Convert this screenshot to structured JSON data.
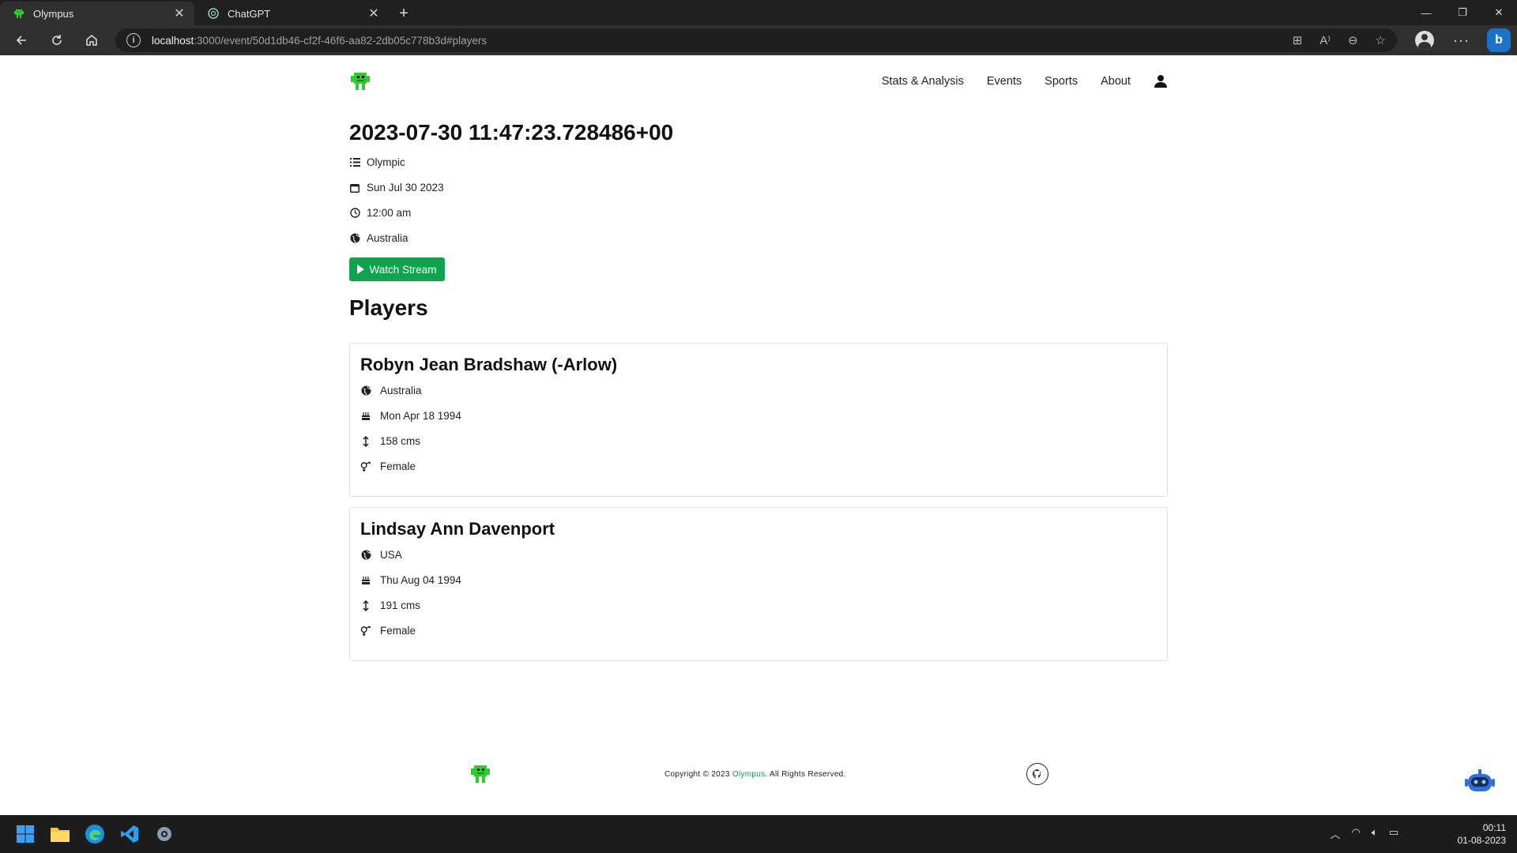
{
  "browser": {
    "tabs": [
      {
        "title": "Olympus",
        "active": true
      },
      {
        "title": "ChatGPT",
        "active": false
      }
    ],
    "address": {
      "host": "localhost",
      "path": ":3000/event/50d1db46-cf2f-46f6-aa82-2db05c778b3d#players"
    },
    "new_tab": "+",
    "more": "···",
    "bing": "b"
  },
  "nav": {
    "items": [
      "Stats & Analysis",
      "Events",
      "Sports",
      "About"
    ]
  },
  "event": {
    "title": "2023-07-30 11:47:23.728486+00",
    "category": "Olympic",
    "date": "Sun Jul 30 2023",
    "time": "12:00 am",
    "location": "Australia",
    "stream_label": "Watch Stream"
  },
  "players": {
    "heading": "Players",
    "list": [
      {
        "name": "Robyn Jean Bradshaw (-Arlow)",
        "country": "Australia",
        "dob": "Mon Apr 18 1994",
        "height": "158 cms",
        "gender": "Female"
      },
      {
        "name": "Lindsay Ann Davenport",
        "country": "USA",
        "dob": "Thu Aug 04 1994",
        "height": "191 cms",
        "gender": "Female"
      }
    ]
  },
  "footer": {
    "copy_prefix": "Copyright © 2023 ",
    "brand": "Olympus",
    "copy_suffix": ". All Rights Reserved."
  },
  "taskbar": {
    "time": "00:11",
    "date": "01-08-2023"
  },
  "colors": {
    "accent": "#10a24e",
    "chrome": "#303030",
    "taskbar": "#1c1c1c"
  }
}
